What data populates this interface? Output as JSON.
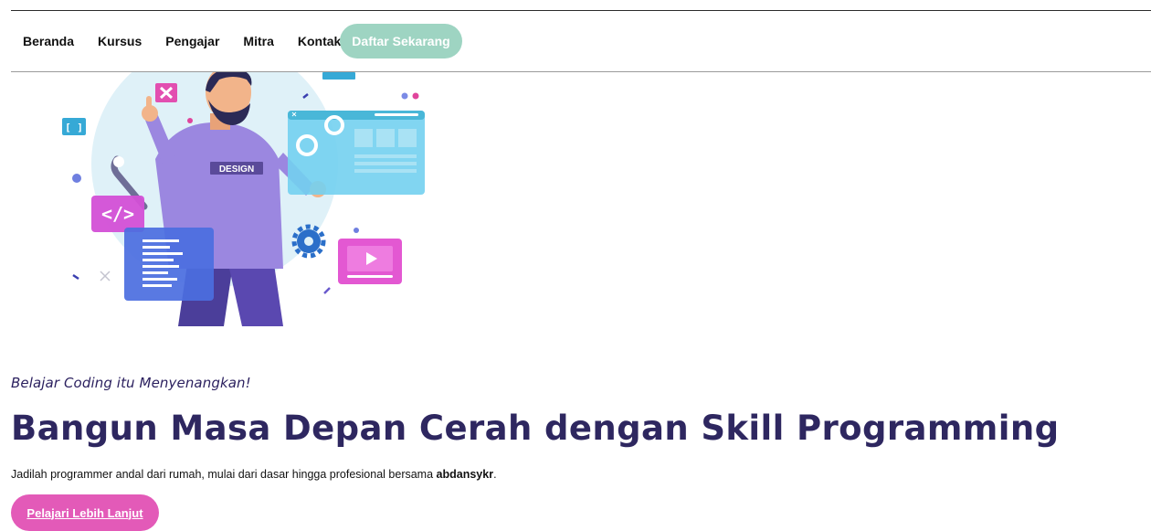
{
  "nav": {
    "items": [
      {
        "label": "Beranda"
      },
      {
        "label": "Kursus"
      },
      {
        "label": "Pengajar"
      },
      {
        "label": "Mitra"
      },
      {
        "label": "Kontak"
      }
    ],
    "cta_label": "Daftar Sekarang"
  },
  "hero": {
    "illustration": {
      "shirt_text": "DESIGN",
      "bracket_text": "[ ]",
      "code_tag_text": "</>",
      "icons": [
        "x-icon",
        "play-icon",
        "gear-icon",
        "wrench-icon",
        "code-window-icon",
        "browser-window-icon"
      ]
    },
    "tagline": "Belajar Coding itu Menyenangkan!",
    "headline": "Bangun Masa Depan Cerah dengan Skill Programming",
    "lead_prefix": "Jadilah programmer andal dari rumah, mulai dari dasar hingga profesional bersama ",
    "lead_brand": "abdansykr",
    "lead_suffix": ".",
    "button_label": "Pelajari Lebih Lanjut"
  },
  "colors": {
    "cta_bg": "#9ed4c2",
    "learn_bg": "#e35ab8",
    "heading": "#2e2760",
    "accent_purple": "#9b87e0",
    "accent_cyan": "#49b7d8"
  }
}
